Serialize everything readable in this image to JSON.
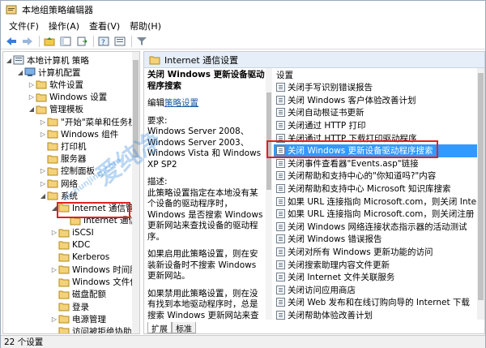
{
  "window": {
    "title": "本地组策略编辑器"
  },
  "menu": [
    "文件(F)",
    "操作(A)",
    "查看(V)",
    "帮助(H)"
  ],
  "toolbar_icons": [
    "back-arrow-icon",
    "forward-arrow-icon",
    "folder-up-icon",
    "show-tree-icon",
    "export-icon",
    "help-icon",
    "properties-icon",
    "filter-icon"
  ],
  "tree": [
    {
      "label": "本地计算机 策略",
      "level": 0,
      "expanded": true
    },
    {
      "label": "计算机配置",
      "level": 1,
      "expanded": true
    },
    {
      "label": "软件设置",
      "level": 2,
      "expanded": false
    },
    {
      "label": "Windows 设置",
      "level": 2,
      "expanded": false
    },
    {
      "label": "管理模板",
      "level": 2,
      "expanded": true
    },
    {
      "label": "\"开始\"菜单和任务栏",
      "level": 3,
      "expanded": false
    },
    {
      "label": "Windows 组件",
      "level": 3,
      "expanded": false
    },
    {
      "label": "打印机",
      "level": 3,
      "expanded": null
    },
    {
      "label": "服务器",
      "level": 3,
      "expanded": null
    },
    {
      "label": "控制面板",
      "level": 3,
      "expanded": false
    },
    {
      "label": "网络",
      "level": 3,
      "expanded": false
    },
    {
      "label": "系统",
      "level": 3,
      "expanded": true
    },
    {
      "label": "Internet 通信管理",
      "level": 4,
      "expanded": true
    },
    {
      "label": "Internet 通信设置",
      "level": 5,
      "expanded": null,
      "selected": true
    },
    {
      "label": "iSCSI",
      "level": 4,
      "expanded": false
    },
    {
      "label": "KDC",
      "level": 4,
      "expanded": null
    },
    {
      "label": "Kerberos",
      "level": 4,
      "expanded": null
    },
    {
      "label": "Windows 时间服务",
      "level": 4,
      "expanded": false
    },
    {
      "label": "Windows 文件保护",
      "level": 4,
      "expanded": null
    },
    {
      "label": "磁盘配额",
      "level": 4,
      "expanded": null
    },
    {
      "label": "登录",
      "level": 4,
      "expanded": null
    },
    {
      "label": "电源管理",
      "level": 4,
      "expanded": false
    },
    {
      "label": "访问被拒绝协助",
      "level": 4,
      "expanded": null
    }
  ],
  "right_header": "Internet 通信设置",
  "description": {
    "title": "关闭 Windows 更新设备驱动程序搜索",
    "edit_prefix": "编辑",
    "edit_link": "策略设置",
    "req_label": "要求:",
    "requirements": "Windows Server 2008、Windows Server 2003、Windows Vista 和 Windows XP SP2",
    "desc_label": "描述:",
    "desc1": "此策略设置指定在本地没有某个设备的驱动程序时，Windows 是否搜索 Windows 更新网站来查找设备的驱动程序。",
    "desc2": "如果启用此策略设置，则在安装新设备时不搜索 Windows 更新网站。",
    "desc3": "如果禁用此策略设置，则在没有找到本地驱动程序时，总是搜索 Windows 更新网站来查找驱动程序。"
  },
  "list_header": "设置",
  "policies": [
    "关闭手写识别错误报告",
    "关闭 Windows 客户体验改善计划",
    "关闭自动根证书更新",
    "关闭通过 HTTP 打印",
    "关闭通过 HTTP 下载打印驱动程序",
    "关闭 Windows 更新设备驱动程序搜索",
    "关闭事件查看器\"Events.asp\"链接",
    "关闭帮助和支持中心的\"你知道吗?\"内容",
    "关闭帮助和支持中心 Microsoft 知识库搜索",
    "如果 URL 连接指向 Microsoft.com，则关闭 Internet 连接...",
    "如果 URL 连接指向 Microsoft.com，则关闭注册",
    "关闭 Windows 网络连接状态指示器的活动测试",
    "关闭 Windows 错误报告",
    "关闭对所有 Windows 更新功能的访问",
    "关闭搜索助理内容文件更新",
    "关闭 Internet 文件关联服务",
    "关闭访问应用商店",
    "关闭 Web 发布和在线订购向导的 Internet 下载",
    "关闭帮助体验改善计划"
  ],
  "selected_policy_index": 5,
  "tabs": [
    "扩展",
    "标准"
  ],
  "status": "22 个设置",
  "watermark": "爱纯净",
  "watermark_url": "aichunjing.com"
}
